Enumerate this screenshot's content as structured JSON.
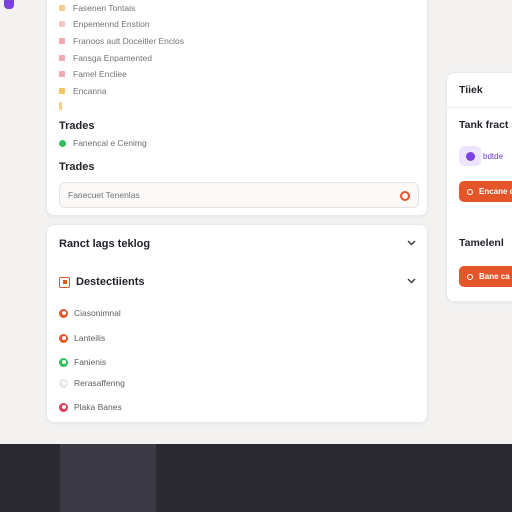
{
  "legend": {
    "items": [
      {
        "label": "Fasenen Tontais",
        "color": "#f6cf8a"
      },
      {
        "label": "Enpemennd Enstion",
        "color": "#f5c9c0"
      },
      {
        "label": "Franoos ault Doceitler Enclos",
        "color": "#f2a9ad"
      },
      {
        "label": "Fansga Enpamented",
        "color": "#f2a9ad"
      },
      {
        "label": "Famel Encliee",
        "color": "#f2a9ad"
      },
      {
        "label": "Encanna",
        "color": "#f6c75a"
      },
      {
        "label": "",
        "color": "#f6cf8a"
      }
    ]
  },
  "trades": {
    "title": "Trades",
    "item": "Fanencal e Cenimg",
    "title2": "Trades",
    "search_placeholder": "Fanecuet Tenenlas"
  },
  "bottom_card": {
    "title": "Ranct lags teklog",
    "subsection_title": "Destectiients",
    "options": [
      {
        "label": "Ciasonimnal",
        "color": "#e4552a"
      },
      {
        "label": "Lanteilis",
        "color": "#e4552a"
      },
      {
        "label": "Fanienis",
        "color": "#2fbf5b"
      },
      {
        "label": "Rerasaffenng",
        "color": "#e9e6e3"
      },
      {
        "label": "Plaka Banes",
        "color": "#e03b5b"
      }
    ]
  },
  "right_panel": {
    "header": "Tiiek",
    "section1_title": "Tank fract",
    "chip_text": "bdtde",
    "button1": "Encane c",
    "section2_title": "Tamelenl",
    "button2": "Bane ca"
  },
  "colors": {
    "accent_orange": "#e4552a",
    "accent_purple": "#7b3fe4",
    "success_green": "#2fbf5b",
    "footer_dark": "#2a2930"
  }
}
